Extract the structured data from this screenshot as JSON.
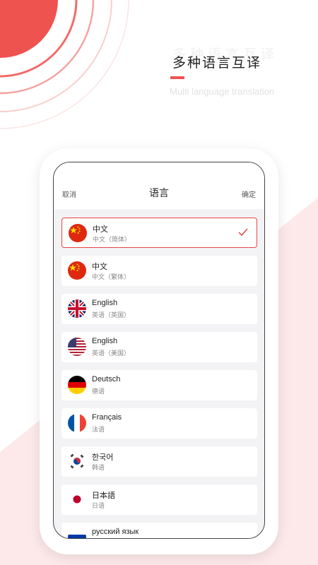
{
  "promo": {
    "headline": "多种语言互译",
    "headline_shadow": "多种语言互译",
    "subheadline": "Multi language translation",
    "accent_color": "#ef5350"
  },
  "picker": {
    "cancel_label": "取消",
    "title": "语言",
    "confirm_label": "确定"
  },
  "languages": [
    {
      "name": "中文",
      "sub": "中文（简体）",
      "flag": "china-flag-icon",
      "selected": true
    },
    {
      "name": "中文",
      "sub": "中文（繁体）",
      "flag": "china-flag-icon",
      "selected": false
    },
    {
      "name": "English",
      "sub": "英语（英国）",
      "flag": "uk-flag-icon",
      "selected": false
    },
    {
      "name": "English",
      "sub": "英语（美国）",
      "flag": "us-flag-icon",
      "selected": false
    },
    {
      "name": "Deutsch",
      "sub": "德语",
      "flag": "germany-flag-icon",
      "selected": false
    },
    {
      "name": "Français",
      "sub": "法语",
      "flag": "france-flag-icon",
      "selected": false
    },
    {
      "name": "한국어",
      "sub": "韩语",
      "flag": "korea-flag-icon",
      "selected": false
    },
    {
      "name": "日本語",
      "sub": "日语",
      "flag": "japan-flag-icon",
      "selected": false
    },
    {
      "name": "русский язык",
      "sub": "",
      "flag": "russia-flag-icon",
      "selected": false
    }
  ]
}
